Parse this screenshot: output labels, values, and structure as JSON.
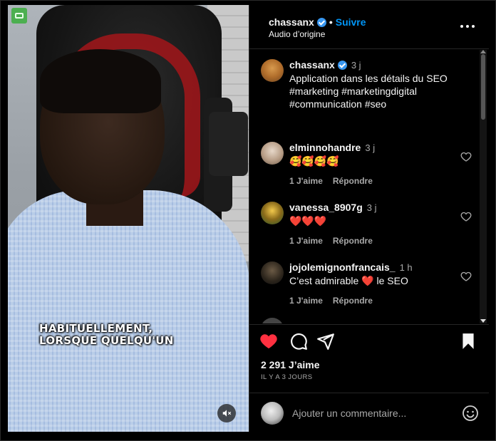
{
  "video": {
    "subtitle_line1": "HABITUELLEMENT,",
    "subtitle_line2": "LORSQUE QUELQU'UN"
  },
  "header": {
    "username": "chassanx",
    "separator": "•",
    "follow_label": "Suivre",
    "audio_label": "Audio d’origine"
  },
  "caption": {
    "username": "chassanx",
    "time": "3 j",
    "text_line1": "Application dans les détails du SEO",
    "text_line2": "#marketing #marketingdigital",
    "text_line3": "#communication #seo"
  },
  "comments": [
    {
      "username": "elminnohandre",
      "time": "3 j",
      "text": "🥰🥰🥰🥰",
      "likes_label": "1 J'aime",
      "reply_label": "Répondre"
    },
    {
      "username": "vanessa_8907g",
      "time": "3 j",
      "text": "❤️❤️❤️",
      "likes_label": "1 J'aime",
      "reply_label": "Répondre"
    },
    {
      "username": "jojolemignonfrancais_",
      "time": "1 h",
      "text_before": "C’est admirable",
      "text_heart": "❤️",
      "text_after": "le SEO",
      "likes_label": "1 J'aime",
      "reply_label": "Répondre"
    }
  ],
  "footer": {
    "likes": "2 291 J’aime",
    "when": "IL Y A 3 JOURS",
    "add_comment_placeholder": "Ajouter un commentaire..."
  },
  "colors": {
    "accent": "#0095f6",
    "like_red": "#ff3040",
    "background": "#000000"
  },
  "icons": [
    "verified-icon",
    "more-options-icon",
    "heart-icon",
    "comment-icon",
    "share-icon",
    "bookmark-icon",
    "emoji-icon",
    "mute-icon"
  ]
}
